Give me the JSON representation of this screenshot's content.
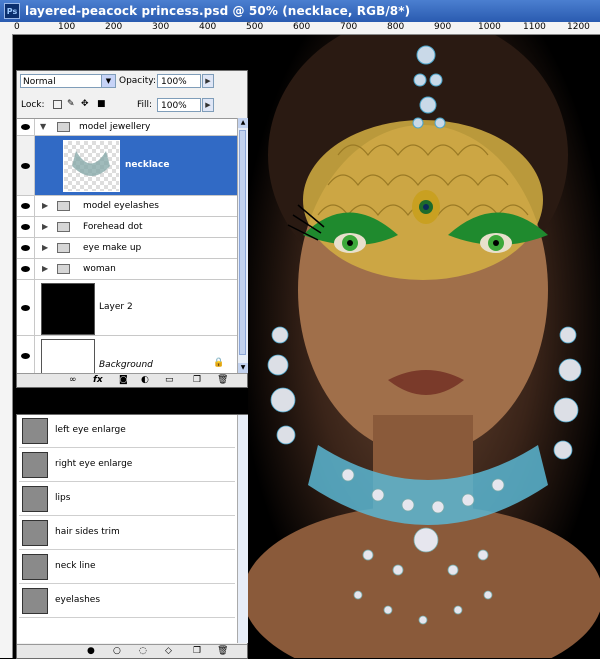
{
  "window": {
    "title": "layered-peacock princess.psd @ 50% (necklace, RGB/8*)",
    "app_icon": "Ps"
  },
  "ruler": {
    "top_labels": [
      "0",
      "100",
      "200",
      "300",
      "400",
      "500",
      "600",
      "700",
      "800",
      "900",
      "1000",
      "1100",
      "1200"
    ]
  },
  "layers_panel": {
    "blend_mode": "Normal",
    "opacity_label": "Opacity:",
    "opacity_value": "100%",
    "lock_label": "Lock:",
    "fill_label": "Fill:",
    "fill_value": "100%",
    "layers": [
      {
        "name": "model jewellery",
        "type": "group",
        "expanded": true
      },
      {
        "name": "necklace",
        "type": "layer",
        "selected": true
      },
      {
        "name": "model eyelashes",
        "type": "group"
      },
      {
        "name": "Forehead dot",
        "type": "group"
      },
      {
        "name": "eye make up",
        "type": "group"
      },
      {
        "name": "woman",
        "type": "group"
      },
      {
        "name": "Layer 2",
        "type": "layer"
      },
      {
        "name": "Background",
        "type": "layer",
        "locked": true
      }
    ],
    "bottom_icons": [
      "link-icon",
      "fx",
      "mask-icon",
      "adjustment-icon",
      "folder-icon",
      "new-layer-icon",
      "trash-icon"
    ]
  },
  "paths_panel": {
    "paths": [
      "left eye enlarge",
      "right eye enlarge",
      "lips",
      "hair sides trim",
      "neck line",
      "eyelashes"
    ],
    "bottom_icons": [
      "fill-path-icon",
      "stroke-path-icon",
      "selection-icon",
      "work-path-icon",
      "new-path-icon",
      "trash-icon"
    ]
  },
  "colors": {
    "selected": "#316ac5",
    "titlebar": "#2a5bb0"
  }
}
